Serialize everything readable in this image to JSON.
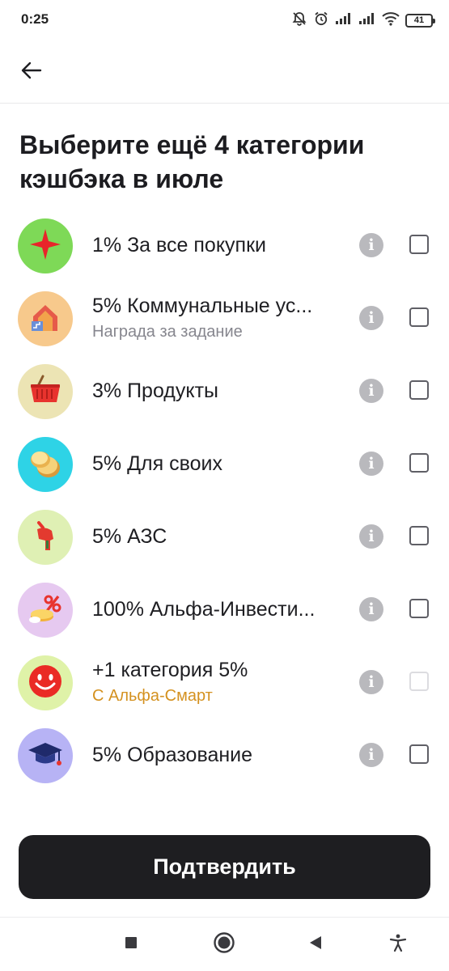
{
  "status_bar": {
    "time": "0:25",
    "battery": "41",
    "icons": [
      "bell-off-icon",
      "alarm-icon",
      "signal-icon",
      "signal-icon",
      "wifi-icon",
      "battery-icon"
    ]
  },
  "header": {
    "back_icon": "arrow-left-icon"
  },
  "title": "Выберите ещё 4 категории кэшбэка в июле",
  "categories": [
    {
      "label": "1% За все покупки",
      "subtitle": "",
      "icon": "red-star-icon",
      "icon_bg": "#7ed957",
      "checked": false,
      "enabled": true
    },
    {
      "label": "5% Коммунальные ус...",
      "subtitle": "Награда за задание",
      "icon": "house-icon",
      "icon_bg": "#f7c98c",
      "checked": false,
      "enabled": true
    },
    {
      "label": "3% Продукты",
      "subtitle": "",
      "icon": "shopping-basket-icon",
      "icon_bg": "#ece4b4",
      "checked": false,
      "enabled": true
    },
    {
      "label": "5% Для своих",
      "subtitle": "",
      "icon": "coins-icon",
      "icon_bg": "#2ed3e6",
      "checked": false,
      "enabled": true
    },
    {
      "label": "5% АЗС",
      "subtitle": "",
      "icon": "fuel-nozzle-icon",
      "icon_bg": "#dff0b4",
      "checked": false,
      "enabled": true
    },
    {
      "label": "100% Альфа-Инвести...",
      "subtitle": "",
      "icon": "percent-coins-icon",
      "icon_bg": "#e6c9f0",
      "checked": false,
      "enabled": true
    },
    {
      "label": "+1 категория 5%",
      "subtitle": "С Альфа-Смарт",
      "icon": "smiley-face-icon",
      "icon_bg": "#dff2a8",
      "checked": false,
      "enabled": false
    },
    {
      "label": "5% Образование",
      "subtitle": "",
      "icon": "graduation-cap-icon",
      "icon_bg": "#b7b3f5",
      "checked": false,
      "enabled": true
    }
  ],
  "info_glyph": "i",
  "confirm_label": "Подтвердить",
  "nav": [
    "recents-square-icon",
    "home-circle-icon",
    "back-triangle-icon",
    "accessibility-icon"
  ],
  "colors": {
    "subtitle_accent": "#d4911f",
    "button_bg": "#1e1e21",
    "info_icon": "#b9b9bd"
  }
}
